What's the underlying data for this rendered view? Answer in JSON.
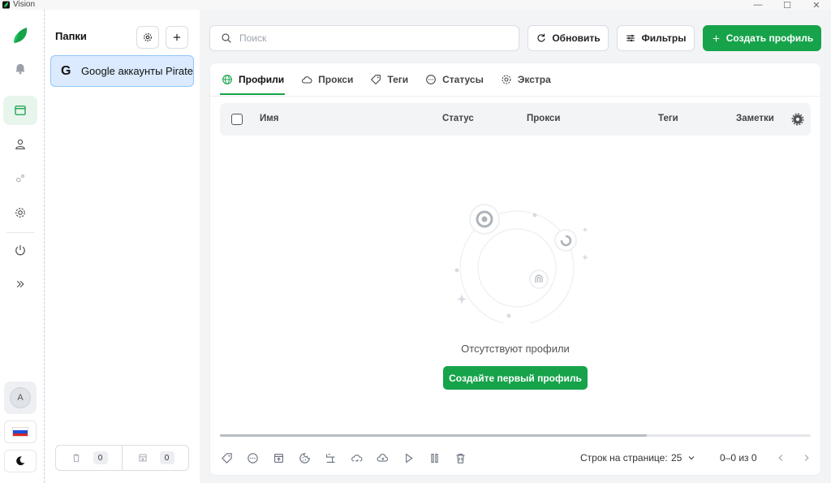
{
  "app": {
    "title": "Vision"
  },
  "window": {
    "minimize": "—",
    "maximize": "☐",
    "close": "✕"
  },
  "rail": {
    "avatar_initial": "A"
  },
  "folders": {
    "title": "Папки",
    "items": [
      {
        "letter": "G",
        "label": "Google аккаунты Pirate"
      }
    ],
    "trash_count": "0",
    "archive_count": "0"
  },
  "toolbar": {
    "search_placeholder": "Поиск",
    "refresh_label": "Обновить",
    "filters_label": "Фильтры",
    "create_label": "Создать профиль"
  },
  "tabs": [
    {
      "label": "Профили",
      "active": true
    },
    {
      "label": "Прокси",
      "active": false
    },
    {
      "label": "Теги",
      "active": false
    },
    {
      "label": "Статусы",
      "active": false
    },
    {
      "label": "Экстра",
      "active": false
    }
  ],
  "table": {
    "columns": {
      "name": "Имя",
      "status": "Статус",
      "proxy": "Прокси",
      "tags": "Теги",
      "notes": "Заметки"
    }
  },
  "empty": {
    "text": "Отсутствуют профили",
    "button": "Создайте первый профиль"
  },
  "pagination": {
    "rows_label": "Строк на странице:",
    "rows_value": "25",
    "range": "0–0 из 0"
  },
  "colors": {
    "accent": "#16a34a",
    "selected_bg": "#dbeafe",
    "selected_border": "#93c5fd"
  }
}
